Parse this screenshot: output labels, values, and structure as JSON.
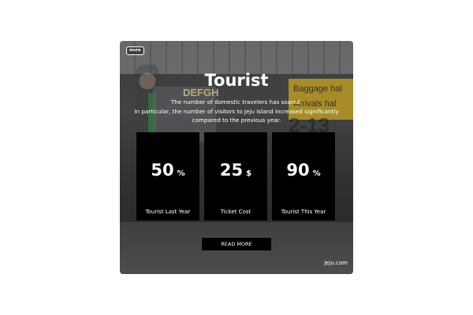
{
  "card": {
    "logo_text": "more",
    "title": "Tourist",
    "subtitle_line1": "The number of domestic travelers has soared.",
    "subtitle_line2": "In particular, the number of visitors to Jeju Island increased significantly",
    "subtitle_line3": "compared to the previous year.",
    "stats": [
      {
        "value": "50",
        "unit": "%",
        "label": "Tourist Last Year"
      },
      {
        "value": "25",
        "unit": "$",
        "label": "Ticket Cost"
      },
      {
        "value": "90",
        "unit": "%",
        "label": "Tourist This Year"
      }
    ],
    "button_label": "READ MORE",
    "site": "jeju.com"
  },
  "background": {
    "sign_text_1": "Baggage hal",
    "sign_text_2": "Arrivals hal",
    "sign_text_3": "2-13",
    "sign_text_4": "DEFGH"
  },
  "colors": {
    "panel": "#000000",
    "text": "#ffffff",
    "sign_yellow": "#c9a520"
  }
}
